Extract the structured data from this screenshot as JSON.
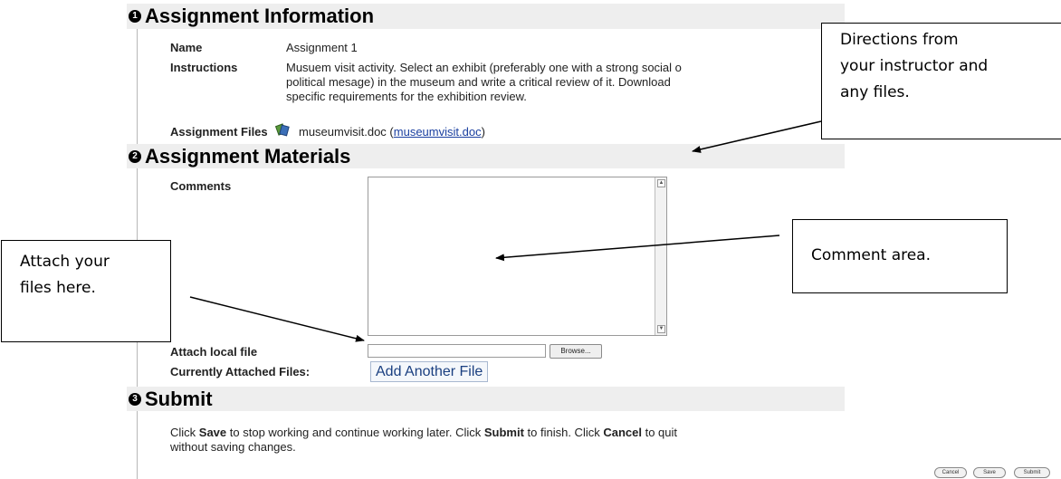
{
  "sections": {
    "info": {
      "number": "1",
      "title": "Assignment Information"
    },
    "materials": {
      "number": "2",
      "title": "Assignment Materials"
    },
    "submit": {
      "number": "3",
      "title": "Submit"
    }
  },
  "info": {
    "name_label": "Name",
    "name_value": "Assignment 1",
    "instructions_label": "Instructions",
    "instructions_line1": "Musuem visit activity.  Select an exhibit (preferably one with a strong social o",
    "instructions_line2": "political mesage) in the museum and write a critical review of it.  Download",
    "instructions_line3": "specific requirements for the exhibition review.",
    "files_label": "Assignment Files",
    "file_name": "museumvisit.doc",
    "file_link": "museumvisit.doc"
  },
  "materials": {
    "comments_label": "Comments",
    "attach_label": "Attach local file",
    "browse_label": "Browse...",
    "current_files_label": "Currently Attached Files:",
    "add_file_label": "Add Another File"
  },
  "submit": {
    "text_part1": "Click ",
    "save_word": "Save",
    "text_part2": " to stop working and continue working later. Click ",
    "submit_word": "Submit",
    "text_part3": " to finish. Click ",
    "cancel_word": "Cancel",
    "text_part4": " to quit",
    "text_line2": "without saving changes.",
    "cancel_button": "Cancel",
    "save_button": "Save",
    "submit_button": "Submit"
  },
  "callouts": {
    "directions_line1": "Directions from",
    "directions_line2": "your instructor and",
    "directions_line3": "any files.",
    "comment_area": "Comment area.",
    "attach_line1": "Attach your",
    "attach_line2": "files here."
  },
  "icons": {
    "file_icon": "document-attachment-icon",
    "section_marker": "numbered-circle-icon"
  },
  "colors": {
    "section_bar": "#eeeeee",
    "link": "#1a3fa0",
    "add_file_text": "#1a3f80"
  }
}
